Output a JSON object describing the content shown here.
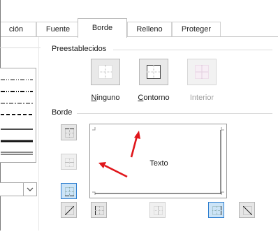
{
  "tabs": [
    {
      "label": "ción",
      "active": false
    },
    {
      "label": "Fuente",
      "active": false
    },
    {
      "label": "Borde",
      "active": true
    },
    {
      "label": "Relleno",
      "active": false
    },
    {
      "label": "Proteger",
      "active": false
    }
  ],
  "presets": {
    "title": "Preestablecidos",
    "items": [
      {
        "label": "Ninguno",
        "accesskey": "N",
        "rest": "inguno",
        "enabled": true
      },
      {
        "label": "Contorno",
        "accesskey": "C",
        "rest": "ontorno",
        "enabled": true
      },
      {
        "label": "Interior",
        "enabled": false
      }
    ]
  },
  "border": {
    "title": "Borde",
    "preview_text": "Texto"
  },
  "colors": {
    "accent": "#2f7fd0",
    "annotation_arrow": "#e0161b"
  },
  "icons": [
    "chevron-down-icon",
    "border-top-icon",
    "border-middle-horizontal-icon",
    "border-bottom-icon",
    "border-diagonal-up-icon",
    "border-left-icon",
    "border-middle-vertical-icon",
    "border-right-icon",
    "border-diagonal-down-icon"
  ]
}
